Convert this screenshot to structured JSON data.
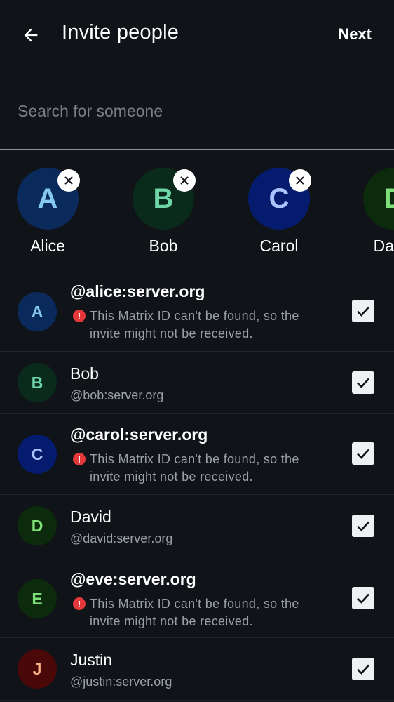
{
  "header": {
    "title": "Invite people",
    "next_label": "Next"
  },
  "search": {
    "placeholder": "Search for someone",
    "value": ""
  },
  "selected": [
    {
      "letter": "A",
      "label": "Alice",
      "bg": "#0b2a5c",
      "fg": "#86c9f0"
    },
    {
      "letter": "B",
      "label": "Bob",
      "bg": "#0a2a1c",
      "fg": "#6fd6a8"
    },
    {
      "letter": "C",
      "label": "Carol",
      "bg": "#051c6e",
      "fg": "#a9c4ff"
    },
    {
      "letter": "D",
      "label": "David",
      "bg": "#0c2a0c",
      "fg": "#7fe07a"
    }
  ],
  "users": [
    {
      "letter": "A",
      "name": "@alice:server.org",
      "bold": true,
      "warning": "This Matrix ID can't be found, so the invite might not be received.",
      "bg": "#0b2a5c",
      "fg": "#86c9f0"
    },
    {
      "letter": "B",
      "name": "Bob",
      "subtitle": "@bob:server.org",
      "bg": "#0a2a1c",
      "fg": "#6fd6a8"
    },
    {
      "letter": "C",
      "name": "@carol:server.org",
      "bold": true,
      "warning": "This Matrix ID can't be found, so the invite might not be received.",
      "bg": "#051c6e",
      "fg": "#a9c4ff"
    },
    {
      "letter": "D",
      "name": "David",
      "subtitle": "@david:server.org",
      "bg": "#0c2a0c",
      "fg": "#7fe07a"
    },
    {
      "letter": "E",
      "name": "@eve:server.org",
      "bold": true,
      "warning": "This Matrix ID can't be found, so the invite might not be received.",
      "bg": "#0c2a0c",
      "fg": "#7fe07a"
    },
    {
      "letter": "J",
      "name": "Justin",
      "subtitle": "@justin:server.org",
      "bg": "#4a0808",
      "fg": "#ffb58a"
    }
  ],
  "icons": {
    "back": "arrow-left-icon",
    "remove": "close-icon",
    "warning": "error-icon",
    "check": "checkmark-icon"
  },
  "colors": {
    "background": "#101317",
    "warning": "#e5383b",
    "secondary_text": "#9aa0a8"
  }
}
